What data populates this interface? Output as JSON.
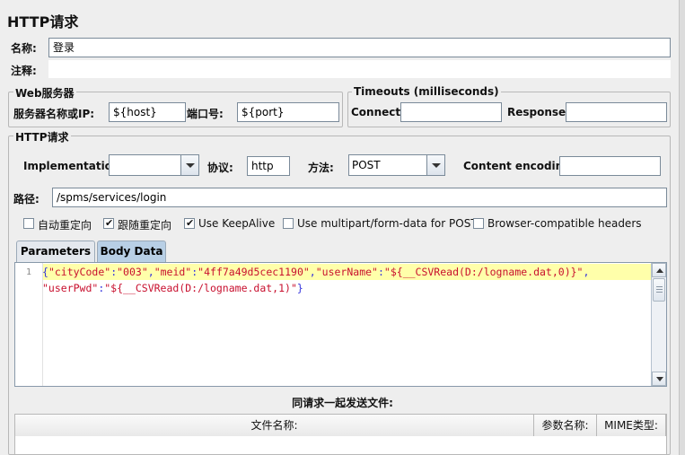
{
  "page": {
    "title": "HTTP请求"
  },
  "name_field": {
    "label": "名称:",
    "value": "登录"
  },
  "comment_field": {
    "label": "注释:",
    "value": ""
  },
  "web_server": {
    "legend": "Web服务器",
    "host_label": "服务器名称或IP:",
    "host_value": "${host}",
    "port_label": "端口号:",
    "port_value": "${port}"
  },
  "timeouts": {
    "legend": "Timeouts (milliseconds)",
    "connect_label": "Connect:",
    "connect_value": "",
    "response_label": "Response:",
    "response_value": ""
  },
  "http_request": {
    "legend": "HTTP请求",
    "implementation_label": "Implementation:",
    "implementation_value": "",
    "protocol_label": "协议:",
    "protocol_value": "http",
    "method_label": "方法:",
    "method_value": "POST",
    "encoding_label": "Content encoding:",
    "encoding_value": "",
    "path_label": "路径:",
    "path_value": "/spms/services/login"
  },
  "options": [
    {
      "label": "自动重定向",
      "checked": false
    },
    {
      "label": "跟随重定向",
      "checked": true
    },
    {
      "label": "Use KeepAlive",
      "checked": true
    },
    {
      "label": "Use multipart/form-data for POST",
      "checked": false
    },
    {
      "label": "Browser-compatible headers",
      "checked": false
    }
  ],
  "tabs": [
    {
      "label": "Parameters",
      "active": false
    },
    {
      "label": "Body Data",
      "active": true
    }
  ],
  "body_data": {
    "line_number": "1",
    "line1": [
      {
        "t": "{",
        "c": "p"
      },
      {
        "t": "\"cityCode\"",
        "c": "k"
      },
      {
        "t": ":",
        "c": "p"
      },
      {
        "t": "\"003\"",
        "c": "k"
      },
      {
        "t": ",",
        "c": "p"
      },
      {
        "t": "\"meid\"",
        "c": "k"
      },
      {
        "t": ":",
        "c": "p"
      },
      {
        "t": "\"4ff7a49d5cec1190\"",
        "c": "k"
      },
      {
        "t": ",",
        "c": "p"
      },
      {
        "t": "\"userName\"",
        "c": "k"
      },
      {
        "t": ":",
        "c": "p"
      },
      {
        "t": "\"${__CSVRead(D:/logname.dat,0)}\"",
        "c": "k"
      },
      {
        "t": ",",
        "c": "p"
      }
    ],
    "line2": [
      {
        "t": "\"userPwd\"",
        "c": "k"
      },
      {
        "t": ":",
        "c": "p"
      },
      {
        "t": "\"${__CSVRead(D:/logname.dat,1)\"",
        "c": "k"
      },
      {
        "t": "}",
        "c": "p"
      }
    ]
  },
  "files": {
    "heading": "同请求一起发送文件:",
    "columns": [
      "文件名称:",
      "参数名称:",
      "MIME类型:"
    ]
  },
  "colors": {
    "code_string": "#c8102e",
    "code_punct": "#3333dd",
    "current_line": "#ffffaa",
    "active_tab": "#b8cfe5"
  }
}
